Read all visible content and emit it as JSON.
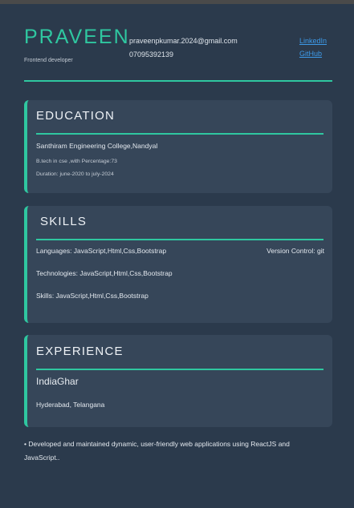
{
  "header": {
    "name": "PRAVEEN",
    "role": "Frontend developer",
    "email": "praveenpkumar.2024@gmail.com",
    "phone": "07095392139",
    "links": [
      "LinkedIn",
      "GitHub"
    ],
    "accent_color": "#2fc7a0"
  },
  "education": {
    "title": "EDUCATION",
    "college": "Santhiram Engineering College,Nandyal",
    "degree": "B.tech in cse ,with Percentage:73",
    "duration": "Duration: june-2020 to july-2024"
  },
  "skills": {
    "title": "SKILLS",
    "languages": "Languages: JavaScript,Html,Css,Bootstrap",
    "version_control": "Version Control: git",
    "technologies": "Technologies: JavaScript,Html,Css,Bootstrap",
    "skills": "Skills: JavaScript,Html,Css,Bootstrap"
  },
  "experience": {
    "title": "EXPERIENCE",
    "company": "IndiaGhar",
    "location": "Hyderabad, Telangana",
    "bullet": "• Developed and maintained dynamic, user-friendly web applications using ReactJS and JavaScript.."
  }
}
